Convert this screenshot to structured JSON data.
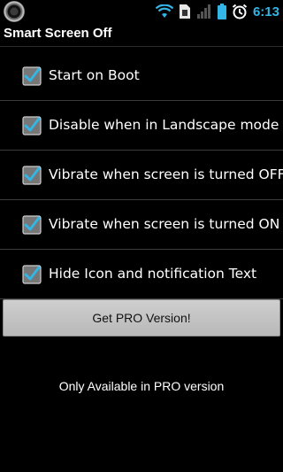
{
  "status_bar": {
    "time": "6:13",
    "icons": [
      "app-icon",
      "wifi-icon",
      "sim-card-icon",
      "signal-icon",
      "battery-icon",
      "alarm-icon"
    ],
    "accent_color": "#33b5e5"
  },
  "app": {
    "title": "Smart Screen Off"
  },
  "settings": [
    {
      "label": "Start on Boot",
      "checked": true
    },
    {
      "label": "Disable when in Landscape mode",
      "checked": true
    },
    {
      "label": "Vibrate when screen is turned OFF",
      "checked": true
    },
    {
      "label": "Vibrate when screen is turned ON",
      "checked": true
    },
    {
      "label": "Hide Icon and notification Text",
      "checked": true
    }
  ],
  "pro_button": {
    "label": "Get PRO Version!"
  },
  "footer": {
    "note": "Only Available in PRO version"
  }
}
